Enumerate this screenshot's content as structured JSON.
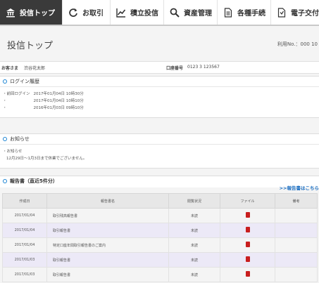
{
  "tabs": [
    {
      "label": "投信トップ",
      "icon": "bank-icon"
    },
    {
      "label": "お取引",
      "icon": "refresh-icon"
    },
    {
      "label": "積立投信",
      "icon": "chart-icon"
    },
    {
      "label": "資産管理",
      "icon": "search-icon"
    },
    {
      "label": "各種手続",
      "icon": "document-icon"
    },
    {
      "label": "電子交付",
      "icon": "document-icon"
    }
  ],
  "page": {
    "title": "投信トップ",
    "user_no": "利用No.：000 10"
  },
  "info": {
    "name_label": "お客さま",
    "name_value": "渋谷花太郎",
    "account_label": "口座番号",
    "account_value": "0123 3 123567"
  },
  "login": {
    "heading": "ログイン履歴",
    "rows": [
      {
        "label": "前回ログイン",
        "value": "2017年01月04日 10時30分"
      },
      {
        "label": "",
        "value": "2017年01月04日 10時10分"
      },
      {
        "label": "",
        "value": "2016年01月03日 09時10分"
      }
    ]
  },
  "notice": {
    "heading": "お知らせ",
    "lines": [
      "お知らせ",
      "12月29日〜1月3日まで休業でございません。"
    ]
  },
  "reports": {
    "heading": "報告書（直近5件分）",
    "more_link": ">>報告書はこちら",
    "columns": [
      "作成日",
      "報告書名",
      "閲覧状況",
      "ファイル",
      "備考"
    ],
    "rows": [
      {
        "date": "2017/01/04",
        "name": "取引残高報告書",
        "status": "未読",
        "file": "pdf",
        "note": ""
      },
      {
        "date": "2017/01/04",
        "name": "取引報告書",
        "status": "未読",
        "file": "pdf",
        "note": ""
      },
      {
        "date": "2017/01/04",
        "name": "特定口座年間取引報告書のご案内",
        "status": "未読",
        "file": "pdf",
        "note": ""
      },
      {
        "date": "2017/01/03",
        "name": "取引報告書",
        "status": "未読",
        "file": "pdf",
        "note": ""
      },
      {
        "date": "2017/01/03",
        "name": "取引報告書",
        "status": "未読",
        "file": "pdf",
        "note": ""
      }
    ]
  },
  "colors": {
    "accent": "#1b84d3",
    "active_tab": "#3a3a3a",
    "pdf_red": "#c81e1e",
    "row_alt": "#ece9f7"
  }
}
